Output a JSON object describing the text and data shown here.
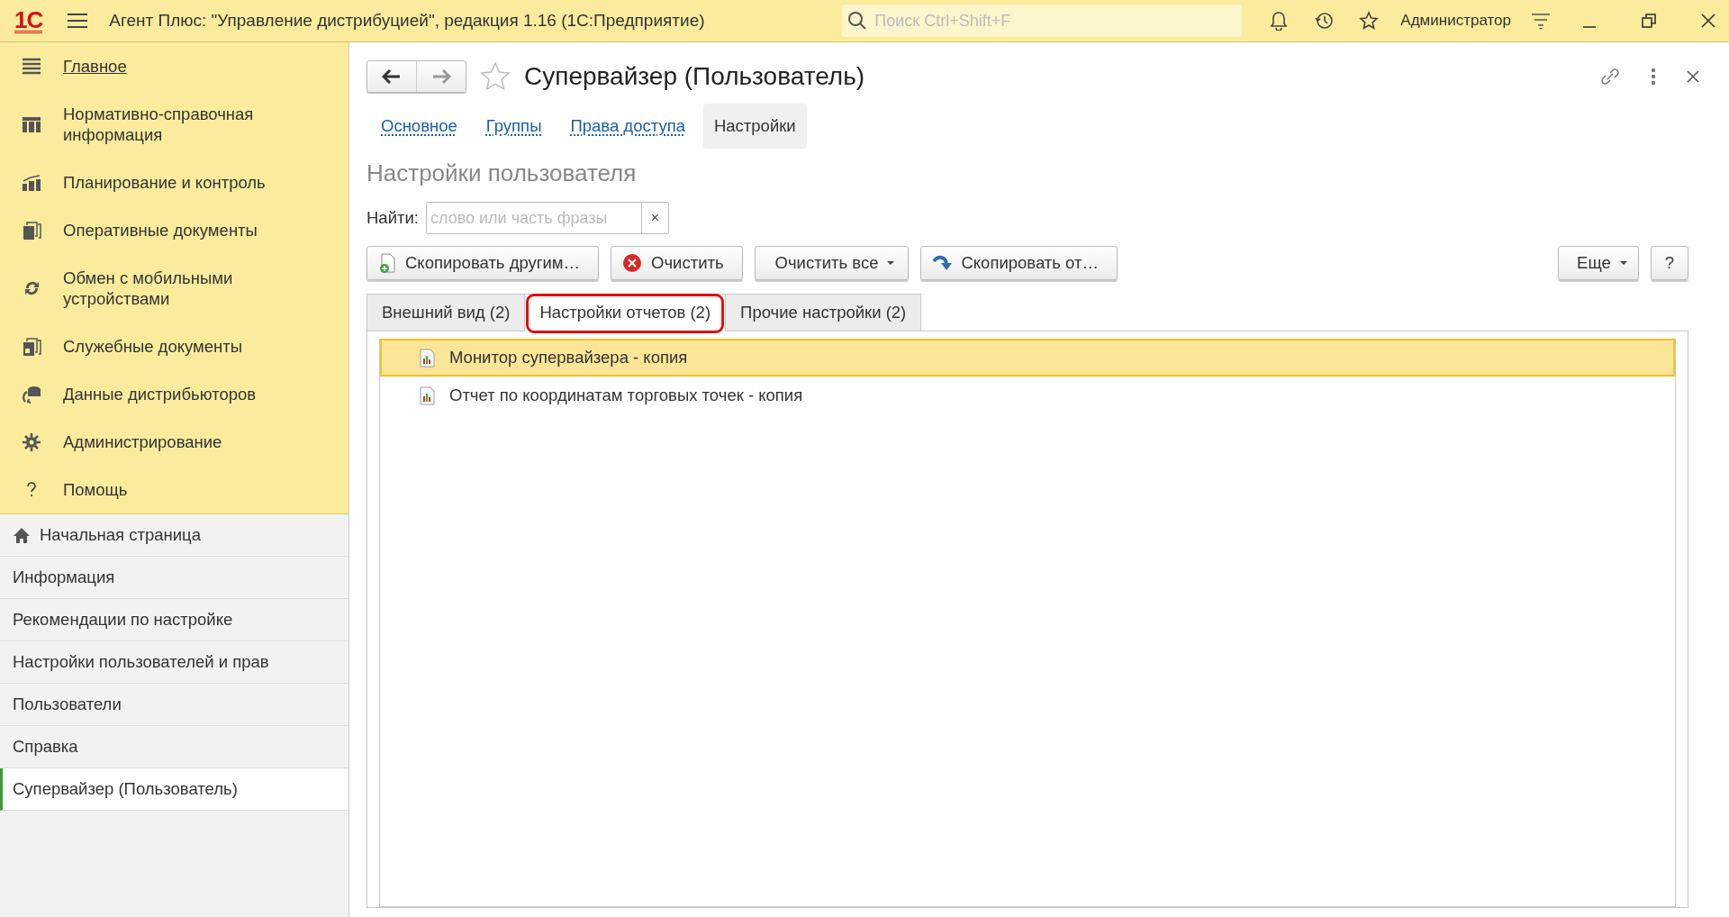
{
  "window": {
    "logo": "1С",
    "title": "Агент Плюс: \"Управление дистрибуцией\", редакция 1.16  (1С:Предприятие)",
    "search_placeholder": "Поиск Ctrl+Shift+F",
    "user": "Администратор"
  },
  "sections": [
    {
      "label": "Главное",
      "selected": true
    },
    {
      "label": "Нормативно-справочная информация",
      "selected": false
    },
    {
      "label": "Планирование и контроль",
      "selected": false
    },
    {
      "label": "Оперативные документы",
      "selected": false
    },
    {
      "label": "Обмен с мобильными устройствами",
      "selected": false
    },
    {
      "label": "Служебные документы",
      "selected": false
    },
    {
      "label": "Данные дистрибьюторов",
      "selected": false
    },
    {
      "label": "Администрирование",
      "selected": false
    },
    {
      "label": "Помощь",
      "selected": false
    }
  ],
  "open_pages": [
    {
      "label": "Начальная страница",
      "kind": "home",
      "selected": false
    },
    {
      "label": "Информация",
      "kind": "page",
      "selected": false
    },
    {
      "label": "Рекомендации по настройке",
      "kind": "page",
      "selected": false
    },
    {
      "label": "Настройки пользователей и прав",
      "kind": "page",
      "selected": false
    },
    {
      "label": "Пользователи",
      "kind": "page",
      "selected": false
    },
    {
      "label": "Справка",
      "kind": "page",
      "selected": false
    },
    {
      "label": "Супервайзер (Пользователь)",
      "kind": "page",
      "selected": true
    }
  ],
  "form": {
    "title": "Супервайзер (Пользователь)",
    "tabs": [
      {
        "label": "Основное",
        "selected": false
      },
      {
        "label": "Группы",
        "selected": false
      },
      {
        "label": "Права доступа",
        "selected": false
      },
      {
        "label": "Настройки",
        "selected": true
      }
    ],
    "heading": "Настройки пользователя",
    "search": {
      "label": "Найти:",
      "placeholder": "слово или часть фразы",
      "clear": "×"
    },
    "buttons": [
      {
        "label": "Скопировать другим…",
        "kind": "copy-to"
      },
      {
        "label": "Очистить",
        "kind": "clear"
      },
      {
        "label": "Очистить все",
        "kind": "menu"
      },
      {
        "label": "Скопировать от…",
        "kind": "copy-from"
      }
    ],
    "more_button": "Еще",
    "help_button": "?",
    "settings_tabs": [
      {
        "label": "Внешний вид (2)",
        "selected": false,
        "annotated": false
      },
      {
        "label": "Настройки отчетов (2)",
        "selected": true,
        "annotated": true
      },
      {
        "label": "Прочие настройки (2)",
        "selected": false,
        "annotated": false
      }
    ],
    "rows": [
      {
        "label": "Монитор супервайзера - копия",
        "selected": true
      },
      {
        "label": "Отчет по координатам торговых точек - копия",
        "selected": false
      }
    ]
  }
}
